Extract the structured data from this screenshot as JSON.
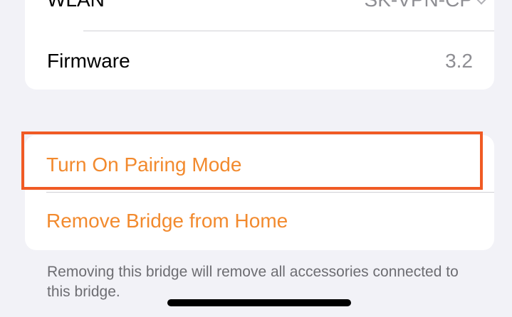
{
  "network": {
    "label": "WLAN",
    "value": "SK-VPN-CP"
  },
  "firmware": {
    "label": "Firmware",
    "value": "3.2"
  },
  "actions": {
    "pairing_mode": "Turn On Pairing Mode",
    "remove_bridge": "Remove Bridge from Home"
  },
  "footer": {
    "note": "Removing this bridge will remove all accessories connected to this bridge."
  },
  "colors": {
    "accent": "#f28a2e",
    "highlight": "#f05a24",
    "background": "#f2f2f7"
  }
}
